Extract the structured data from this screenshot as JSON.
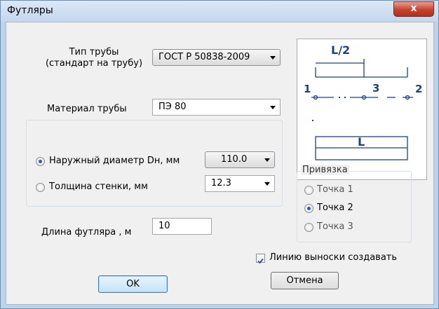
{
  "window": {
    "title": "Футляры",
    "close_label": "x"
  },
  "pipe_type": {
    "label": "Тип трубы\n(стандарт на трубу)",
    "value": "ГОСТ Р 50838-2009"
  },
  "material": {
    "label": "Материал трубы",
    "value": "ПЭ 80"
  },
  "dimension": {
    "outer_diameter": {
      "label": "Наружный диаметр Dн, мм",
      "value": "110.0",
      "selected": true
    },
    "wall_thickness": {
      "label": "Толщина стенки, мм",
      "value": "12.3",
      "selected": false
    }
  },
  "case_length": {
    "label": "Длина футляра , м",
    "value": "10"
  },
  "diagram": {
    "half_label": "L/2",
    "full_label": "L",
    "point1": "1",
    "point2": "2",
    "point3": "3"
  },
  "anchor": {
    "title": "Привязка",
    "options": [
      {
        "label": "Точка 1",
        "selected": false
      },
      {
        "label": "Точка 2",
        "selected": true
      },
      {
        "label": "Точка 3",
        "selected": false
      }
    ]
  },
  "leader_line": {
    "label": "Линию выноски создавать",
    "checked": true
  },
  "buttons": {
    "ok": "OK",
    "cancel": "Отмена"
  },
  "colors": {
    "diagram_blue": "#1f3f8f",
    "radio_dot": "#2a5db0"
  }
}
